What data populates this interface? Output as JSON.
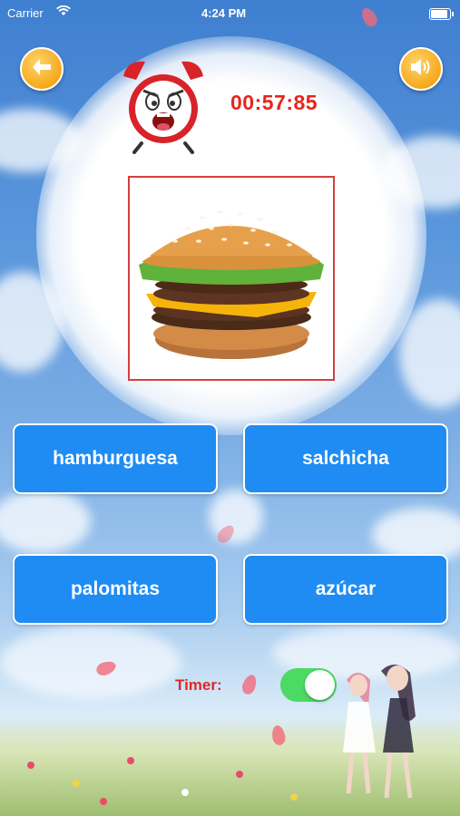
{
  "status_bar": {
    "carrier": "Carrier",
    "time": "4:24 PM"
  },
  "header": {
    "back_icon": "back-arrow-icon",
    "sound_icon": "speaker-icon",
    "alarm_icon": "alarm-clock-icon",
    "countdown": "00:57:85"
  },
  "question": {
    "image": "hamburger"
  },
  "answers": [
    {
      "label": "hamburguesa"
    },
    {
      "label": "salchicha"
    },
    {
      "label": "palomitas"
    },
    {
      "label": "azúcar"
    }
  ],
  "timer_toggle": {
    "label": "Timer:",
    "on": true
  },
  "colors": {
    "answer_bg": "#1f8cf3",
    "timer_red": "#e8241b",
    "toggle_on": "#4cd964",
    "round_button": "#f6a81b"
  }
}
